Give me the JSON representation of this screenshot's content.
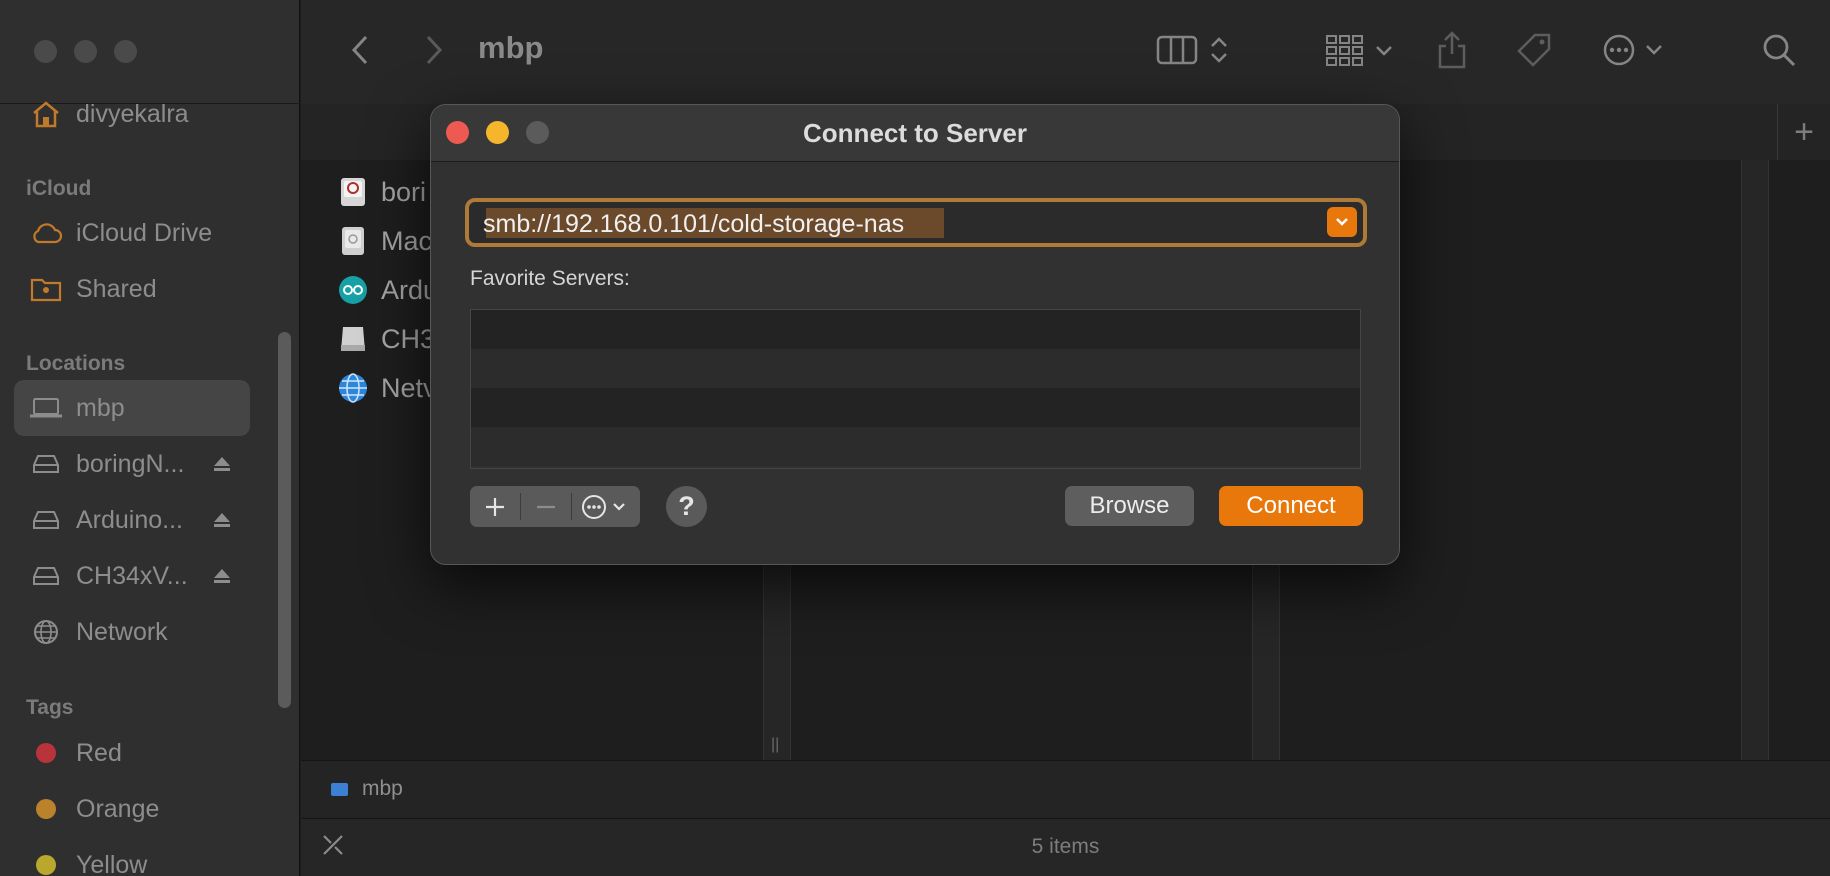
{
  "finder": {
    "title": "mbp",
    "sidebar": {
      "home_item": "divyekalra",
      "sections": {
        "icloud": "iCloud",
        "locations": "Locations",
        "tags": "Tags"
      },
      "icloud_items": [
        "iCloud Drive",
        "Shared"
      ],
      "location_items": [
        "mbp",
        "boringN...",
        "Arduino...",
        "CH34xV...",
        "Network"
      ],
      "tags": [
        {
          "label": "Red",
          "color": "#b8343a"
        },
        {
          "label": "Orange",
          "color": "#b9822b"
        },
        {
          "label": "Yellow",
          "color": "#b9a82b"
        }
      ]
    },
    "files": [
      "bori",
      "Mac",
      "Ardu",
      "CH3",
      "Netv"
    ],
    "pathbar": "mbp",
    "status": "5 items"
  },
  "dialog": {
    "title": "Connect to Server",
    "server_address": "smb://192.168.0.101/cold-storage-nas",
    "favorites_label": "Favorite Servers:",
    "help_label": "?",
    "browse_label": "Browse",
    "connect_label": "Connect"
  },
  "colors": {
    "accent": "#e8770c",
    "close": "#ee5a52",
    "minimize": "#f5b62c",
    "disabled": "#5b5b5c"
  }
}
